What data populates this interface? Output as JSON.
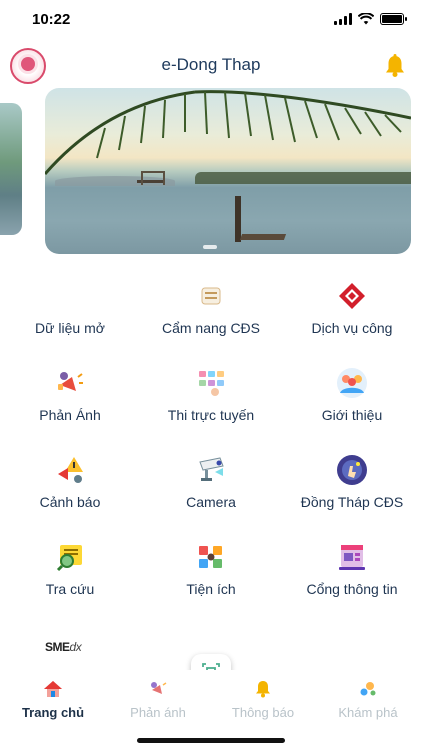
{
  "status": {
    "time": "10:22"
  },
  "header": {
    "title": "e-Dong Thap"
  },
  "grid": [
    {
      "label": "Dữ liệu mở",
      "icon": "open-data-icon"
    },
    {
      "label": "Cẩm nang CĐS",
      "icon": "handbook-icon"
    },
    {
      "label": "Dịch vụ công",
      "icon": "public-service-icon"
    },
    {
      "label": "Phản Ánh",
      "icon": "feedback-icon"
    },
    {
      "label": "Thi trực tuyến",
      "icon": "online-exam-icon"
    },
    {
      "label": "Giới thiệu",
      "icon": "introduction-icon"
    },
    {
      "label": "Cảnh báo",
      "icon": "warning-icon"
    },
    {
      "label": "Camera",
      "icon": "camera-icon"
    },
    {
      "label": "Đồng Tháp CĐS",
      "icon": "dong-thap-digital-icon"
    },
    {
      "label": "Tra cứu",
      "icon": "lookup-icon"
    },
    {
      "label": "Tiện ích",
      "icon": "utilities-icon"
    },
    {
      "label": "Cổng thông tin",
      "icon": "portal-icon"
    }
  ],
  "sme": {
    "brand": "SME",
    "suffix": "dx"
  },
  "tabs": [
    {
      "label": "Trang chủ",
      "icon": "home-icon",
      "active": true
    },
    {
      "label": "Phản ánh",
      "icon": "feedback-tab-icon",
      "active": false
    },
    {
      "label": "Thông báo",
      "icon": "notification-icon",
      "active": false
    },
    {
      "label": "Khám phá",
      "icon": "explore-icon",
      "active": false
    }
  ],
  "colors": {
    "accent": "#1d3148",
    "inactive": "#b9c3c9",
    "bell": "#f4b400"
  }
}
